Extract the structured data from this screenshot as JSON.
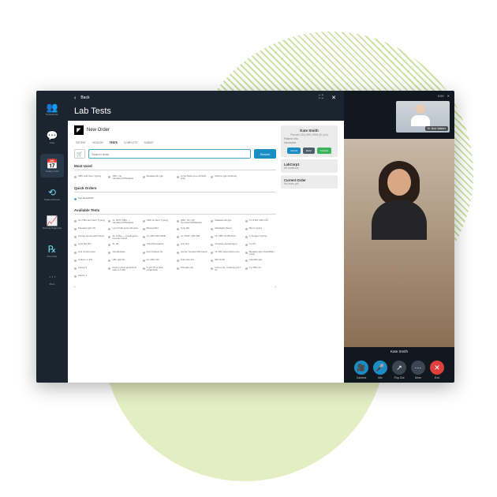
{
  "rail": [
    {
      "icon": "👥",
      "label": "Participants"
    },
    {
      "icon": "💬",
      "label": "Chat"
    },
    {
      "icon": "📅",
      "label": "Today's Visit"
    },
    {
      "icon": "⟲",
      "label": "Patient Record"
    },
    {
      "icon": "📈",
      "label": "Nursing Diagnosis"
    },
    {
      "icon": "℞",
      "label": "Prescribe"
    },
    {
      "icon": "⋯",
      "label": "More"
    }
  ],
  "header": {
    "back": "Back",
    "title": "Lab Tests",
    "new_order": "New Order",
    "timer": "0:00"
  },
  "tabs": [
    "PATIENT",
    "VENDOR",
    "TESTS",
    "COMPLETE",
    "SUBMIT"
  ],
  "search": {
    "placeholder": "Search tests",
    "button": "Search"
  },
  "sections": {
    "most_used": "Most Used",
    "quick_orders": "Quick Orders",
    "available": "Available Tests"
  },
  "most_used": [
    "CBC and Sero Typing",
    "CBC, No Hematocrit/Platelets",
    "Measles Ab IgG",
    "LymeTotal Lyme Ab/HCL Auto",
    "Mumps IgG Antibody"
  ],
  "quick_orders": [
    "Sed Rate/ESR"
  ],
  "available": [
    "CL CBC and Sero Typing",
    "CL STAT CBC — Hematocrit/Platelets",
    "CBC w/ Sero Typing",
    "CBC, No, CP Hematocrit/Platelets",
    "Measles Ab IgG",
    "CL STAT CBC.NH",
    "Measles IgG HS",
    "LymeTotal Lyme Ab auto",
    "Manual RH",
    "Cyto RH",
    "Metabolic Panel",
    "Mpox typing",
    "Carrier 10 Genetic Panel",
    "AL w/Ret — Cardiogram Genetic Panel",
    "CL CBC RR w/Diff",
    "CL STAT CBC RR",
    "CL CBC.As BioTech",
    "C Antigen Typing",
    "Cyto RH DD",
    "AL RT",
    "TSH Monopanel",
    "Anti Ret",
    "Amylase Autoantigen",
    "CL RT",
    "Anti Centromere",
    "Candiosides",
    "Anti Nuclear Ab",
    "Carrier Genetic RR panel",
    "CL RR panel Add-on/ox",
    "Measles IgG CGH/MSH panel",
    "Culture or PH",
    "HBc IgM Ab",
    "CL CBC NG",
    "Anti-mito AG",
    "RR Smith",
    "Candida IgG",
    "Factor 9",
    "Factor/ phos globulin/K ratio A-1 MS",
    "T-ghr Phos HDL pa/globulin",
    "Phospho-IG",
    "Immun IG, Cosblomy/A7 IG",
    "CL CBC.As",
    "Factor 4"
  ],
  "patient": {
    "name": "Kate Smith",
    "sub": "Female   (31) 555-1996 (31 y/o)",
    "lines": [
      "Patient Info",
      "Insurance"
    ],
    "btn_a": "Cancel",
    "btn_b": "Back",
    "btn_c": "Confirm"
  },
  "order_cards": {
    "lab": "LabCorp1",
    "lab_sub": "All locations",
    "cur": "Current Order",
    "cur_sub": "No tests yet"
  },
  "video": {
    "pip_name": "Dr. Bob Walker",
    "main_name": "Kate Smith",
    "btns": [
      {
        "c": "blue",
        "i": "🎥",
        "l": "Camera"
      },
      {
        "c": "blue",
        "i": "🎤",
        "l": "Mic"
      },
      {
        "c": "grey",
        "i": "↗",
        "l": "Pop Out"
      },
      {
        "c": "grey",
        "i": "⋯",
        "l": "More"
      },
      {
        "c": "red",
        "i": "✕",
        "l": "End"
      }
    ]
  }
}
